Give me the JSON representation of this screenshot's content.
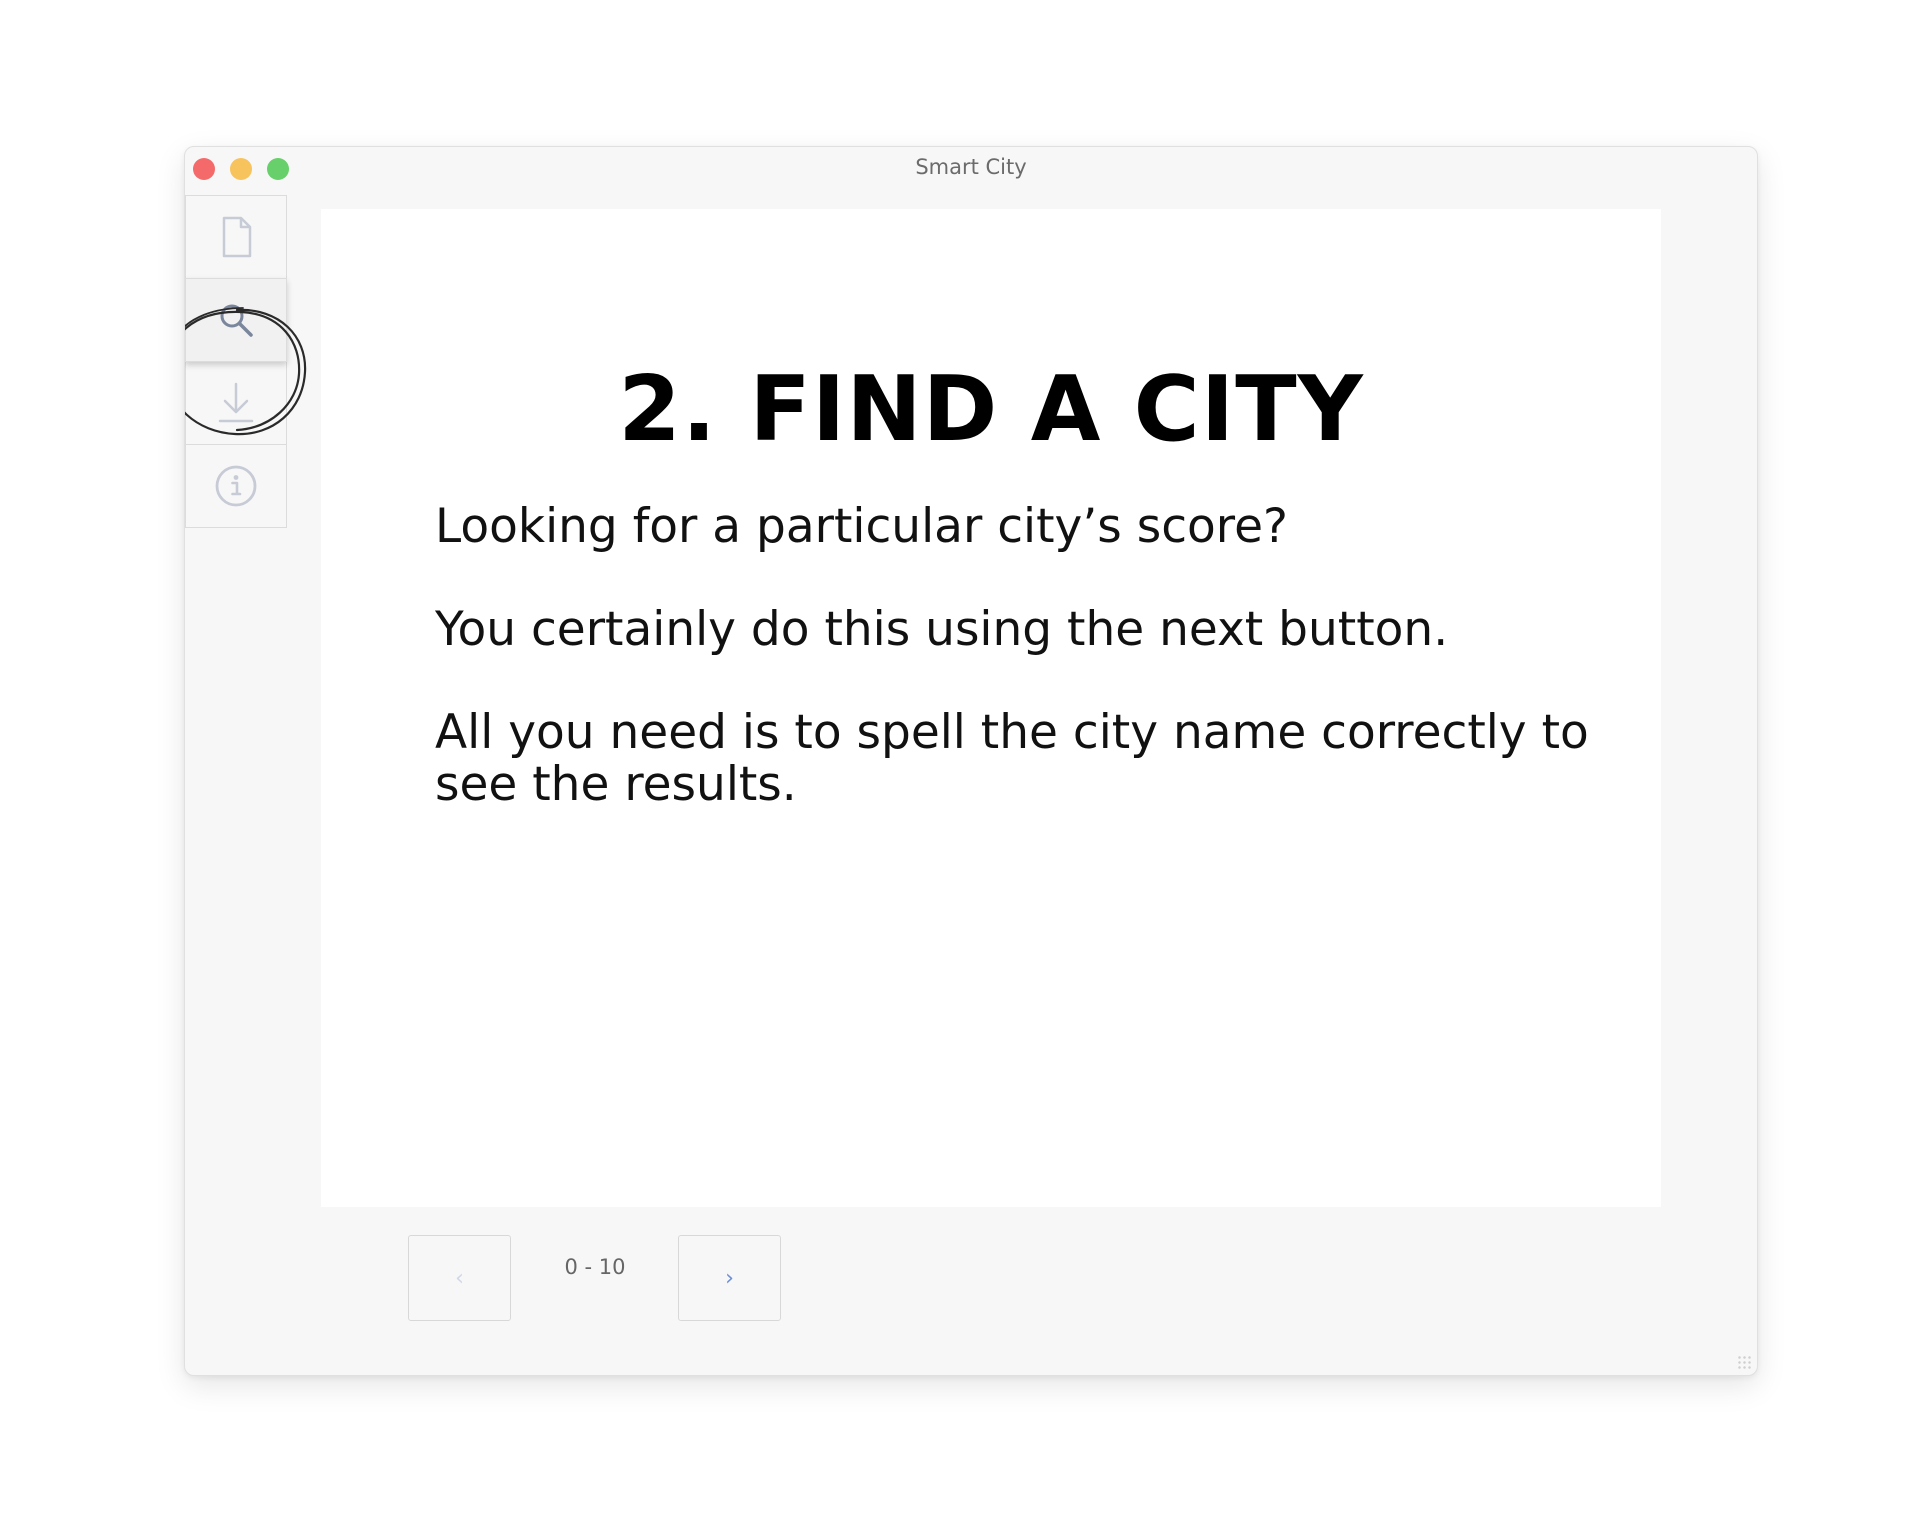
{
  "window": {
    "title": "Smart City"
  },
  "sidebar": {
    "items": [
      {
        "icon": "document-icon",
        "name": "document"
      },
      {
        "icon": "search-icon",
        "name": "search",
        "active": true
      },
      {
        "icon": "download-icon",
        "name": "download"
      },
      {
        "icon": "info-icon",
        "name": "info"
      }
    ]
  },
  "main": {
    "heading": "2. FIND A CITY",
    "paragraphs": [
      "Looking for a particular city’s score?",
      "You certainly do this using the next button.",
      "All you need is to spell the city name correctly to see the results."
    ]
  },
  "pagination": {
    "prev_label": "‹",
    "next_label": "›",
    "range": "0 - 10"
  },
  "colors": {
    "close": "#f46a6a",
    "minimize": "#f7c35d",
    "maximize": "#67d06a",
    "icon_gray": "#c7cbd6",
    "icon_active": "#7a869c",
    "next_accent": "#6e8fd6"
  }
}
